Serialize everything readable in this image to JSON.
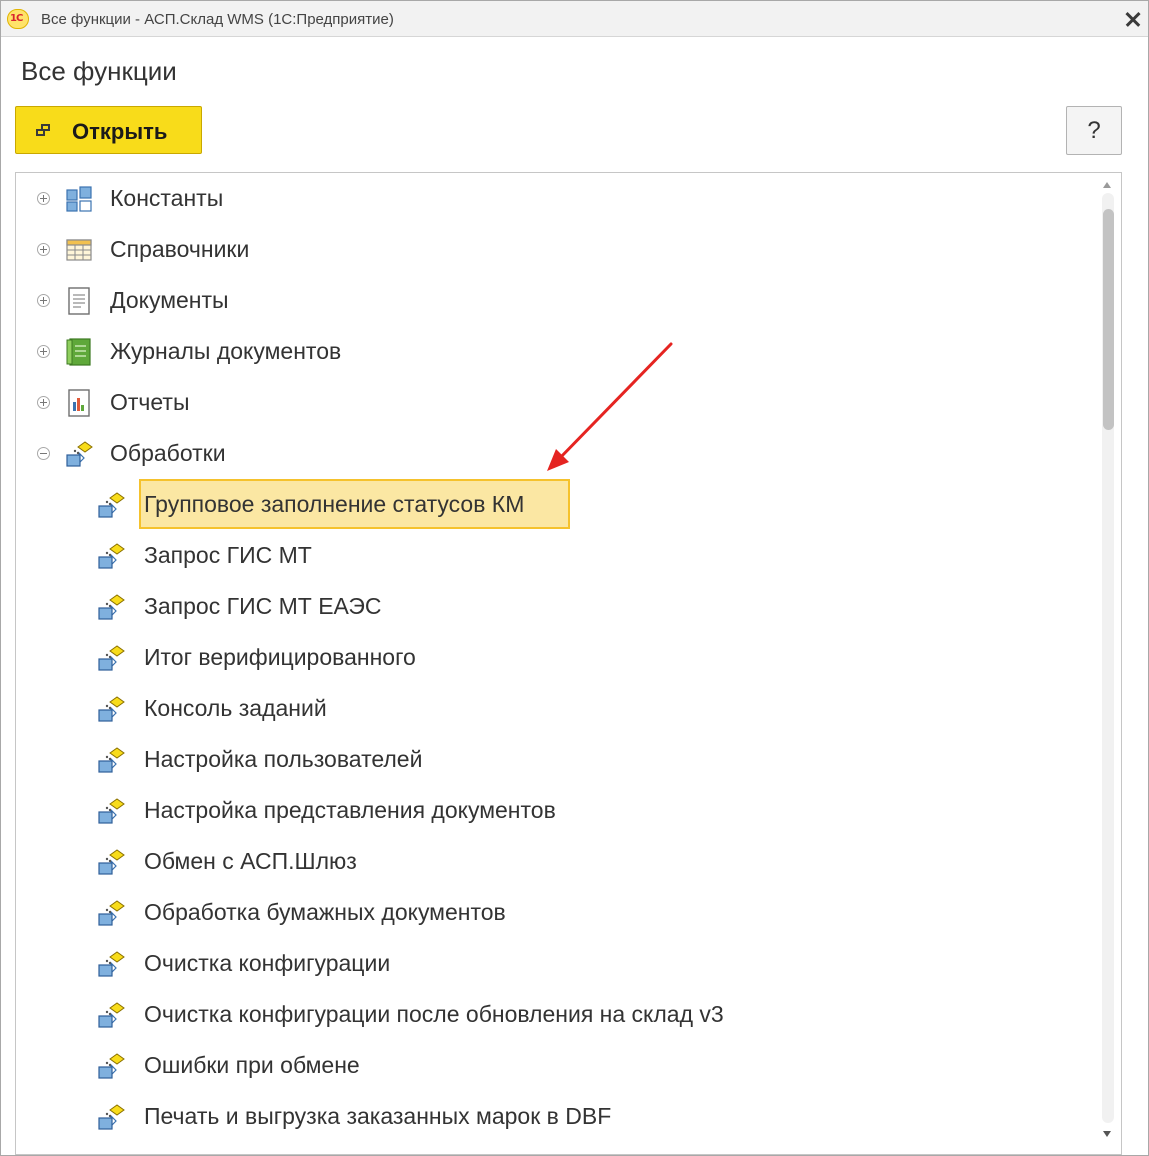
{
  "window": {
    "title": "Все функции - АСП.Склад WMS  (1С:Предприятие)",
    "logo_text": "1С"
  },
  "page": {
    "title": "Все функции"
  },
  "toolbar": {
    "open_label": "Открыть",
    "help_label": "?"
  },
  "tree": {
    "top_items": [
      {
        "label": "Константы",
        "icon": "constants-icon",
        "state": "collapsed"
      },
      {
        "label": "Справочники",
        "icon": "catalogs-icon",
        "state": "collapsed"
      },
      {
        "label": "Документы",
        "icon": "documents-icon",
        "state": "collapsed"
      },
      {
        "label": "Журналы документов",
        "icon": "document-journals-icon",
        "state": "collapsed"
      },
      {
        "label": "Отчеты",
        "icon": "reports-icon",
        "state": "collapsed"
      },
      {
        "label": "Обработки",
        "icon": "data-processors-icon",
        "state": "expanded"
      }
    ],
    "processor_items": [
      {
        "label": "Групповое заполнение статусов КМ",
        "selected": true
      },
      {
        "label": "Запрос ГИС МТ"
      },
      {
        "label": "Запрос ГИС МТ ЕАЭС"
      },
      {
        "label": "Итог верифицированного"
      },
      {
        "label": "Консоль заданий"
      },
      {
        "label": "Настройка пользователей"
      },
      {
        "label": "Настройка представления документов"
      },
      {
        "label": "Обмен с АСП.Шлюз"
      },
      {
        "label": "Обработка бумажных документов"
      },
      {
        "label": "Очистка конфигурации"
      },
      {
        "label": "Очистка конфигурации после обновления на склад v3"
      },
      {
        "label": "Ошибки при обмене"
      },
      {
        "label": "Печать и выгрузка заказанных марок в DBF"
      }
    ]
  },
  "colors": {
    "accent_button": "#f8dc1a",
    "selection_fill": "#fbe7a3",
    "selection_border": "#f5c22d",
    "annotation_arrow": "#e52421"
  }
}
